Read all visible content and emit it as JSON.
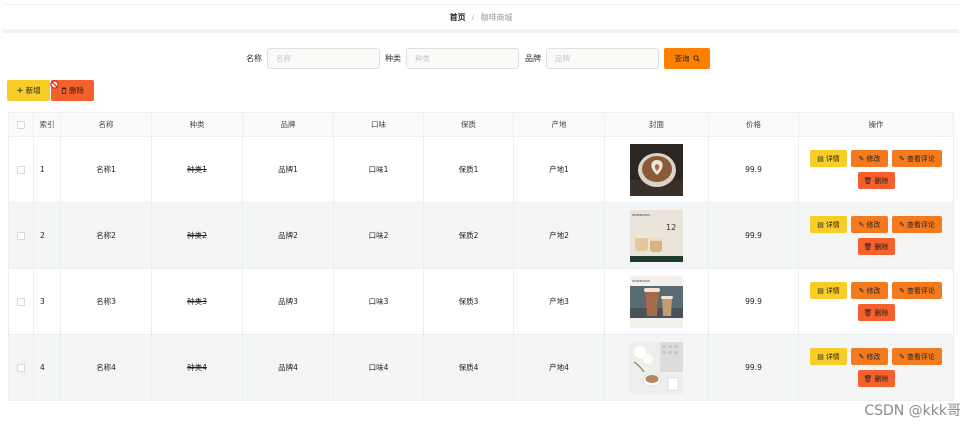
{
  "breadcrumb": {
    "home": "首页",
    "separator": "/",
    "current": "咖啡商城"
  },
  "search": {
    "name_label": "名称",
    "name_placeholder": "名称",
    "type_label": "种类",
    "type_placeholder": "种类",
    "brand_label": "品牌",
    "brand_placeholder": "品牌",
    "query_label": "查询"
  },
  "toolbar": {
    "add_label": "新增",
    "delete_label": "删除"
  },
  "table": {
    "headers": [
      "",
      "索引",
      "名称",
      "种类",
      "品牌",
      "口味",
      "保质",
      "产地",
      "封面",
      "价格",
      "操作"
    ],
    "rows": [
      {
        "index": "1",
        "name": "名称1",
        "type": "种类1",
        "brand": "品牌1",
        "flavor": "口味1",
        "shelf": "保质1",
        "origin": "产地1",
        "price": "99.9",
        "cover": "latte-art-cup"
      },
      {
        "index": "2",
        "name": "名称2",
        "type": "种类2",
        "brand": "品牌2",
        "flavor": "口味2",
        "shelf": "保质2",
        "origin": "产地2",
        "price": "99.9",
        "cover": "starbucks-promo-cups",
        "cover_text": {
          "brand": "STARBUCKS",
          "day": "12"
        }
      },
      {
        "index": "3",
        "name": "名称3",
        "type": "种类3",
        "brand": "品牌3",
        "flavor": "口味3",
        "shelf": "保质3",
        "origin": "产地3",
        "price": "99.9",
        "cover": "starbucks-iced-drink",
        "cover_text": {
          "brand": "STARBUCKS"
        }
      },
      {
        "index": "4",
        "name": "名称4",
        "type": "种类4",
        "brand": "品牌4",
        "flavor": "口味4",
        "shelf": "保质4",
        "origin": "产地4",
        "price": "99.9",
        "cover": "coffee-flowers-keyboard"
      }
    ],
    "actions": {
      "detail": "详情",
      "edit": "修改",
      "review": "查看评论",
      "delete": "删除"
    }
  },
  "watermark": "CSDN @kkk哥",
  "colors": {
    "yellow": "#f9cd27",
    "orange": "#f47a1f",
    "red_orange": "#f6602a",
    "query": "#ff7f00",
    "stripe": "#f3f6f5"
  }
}
